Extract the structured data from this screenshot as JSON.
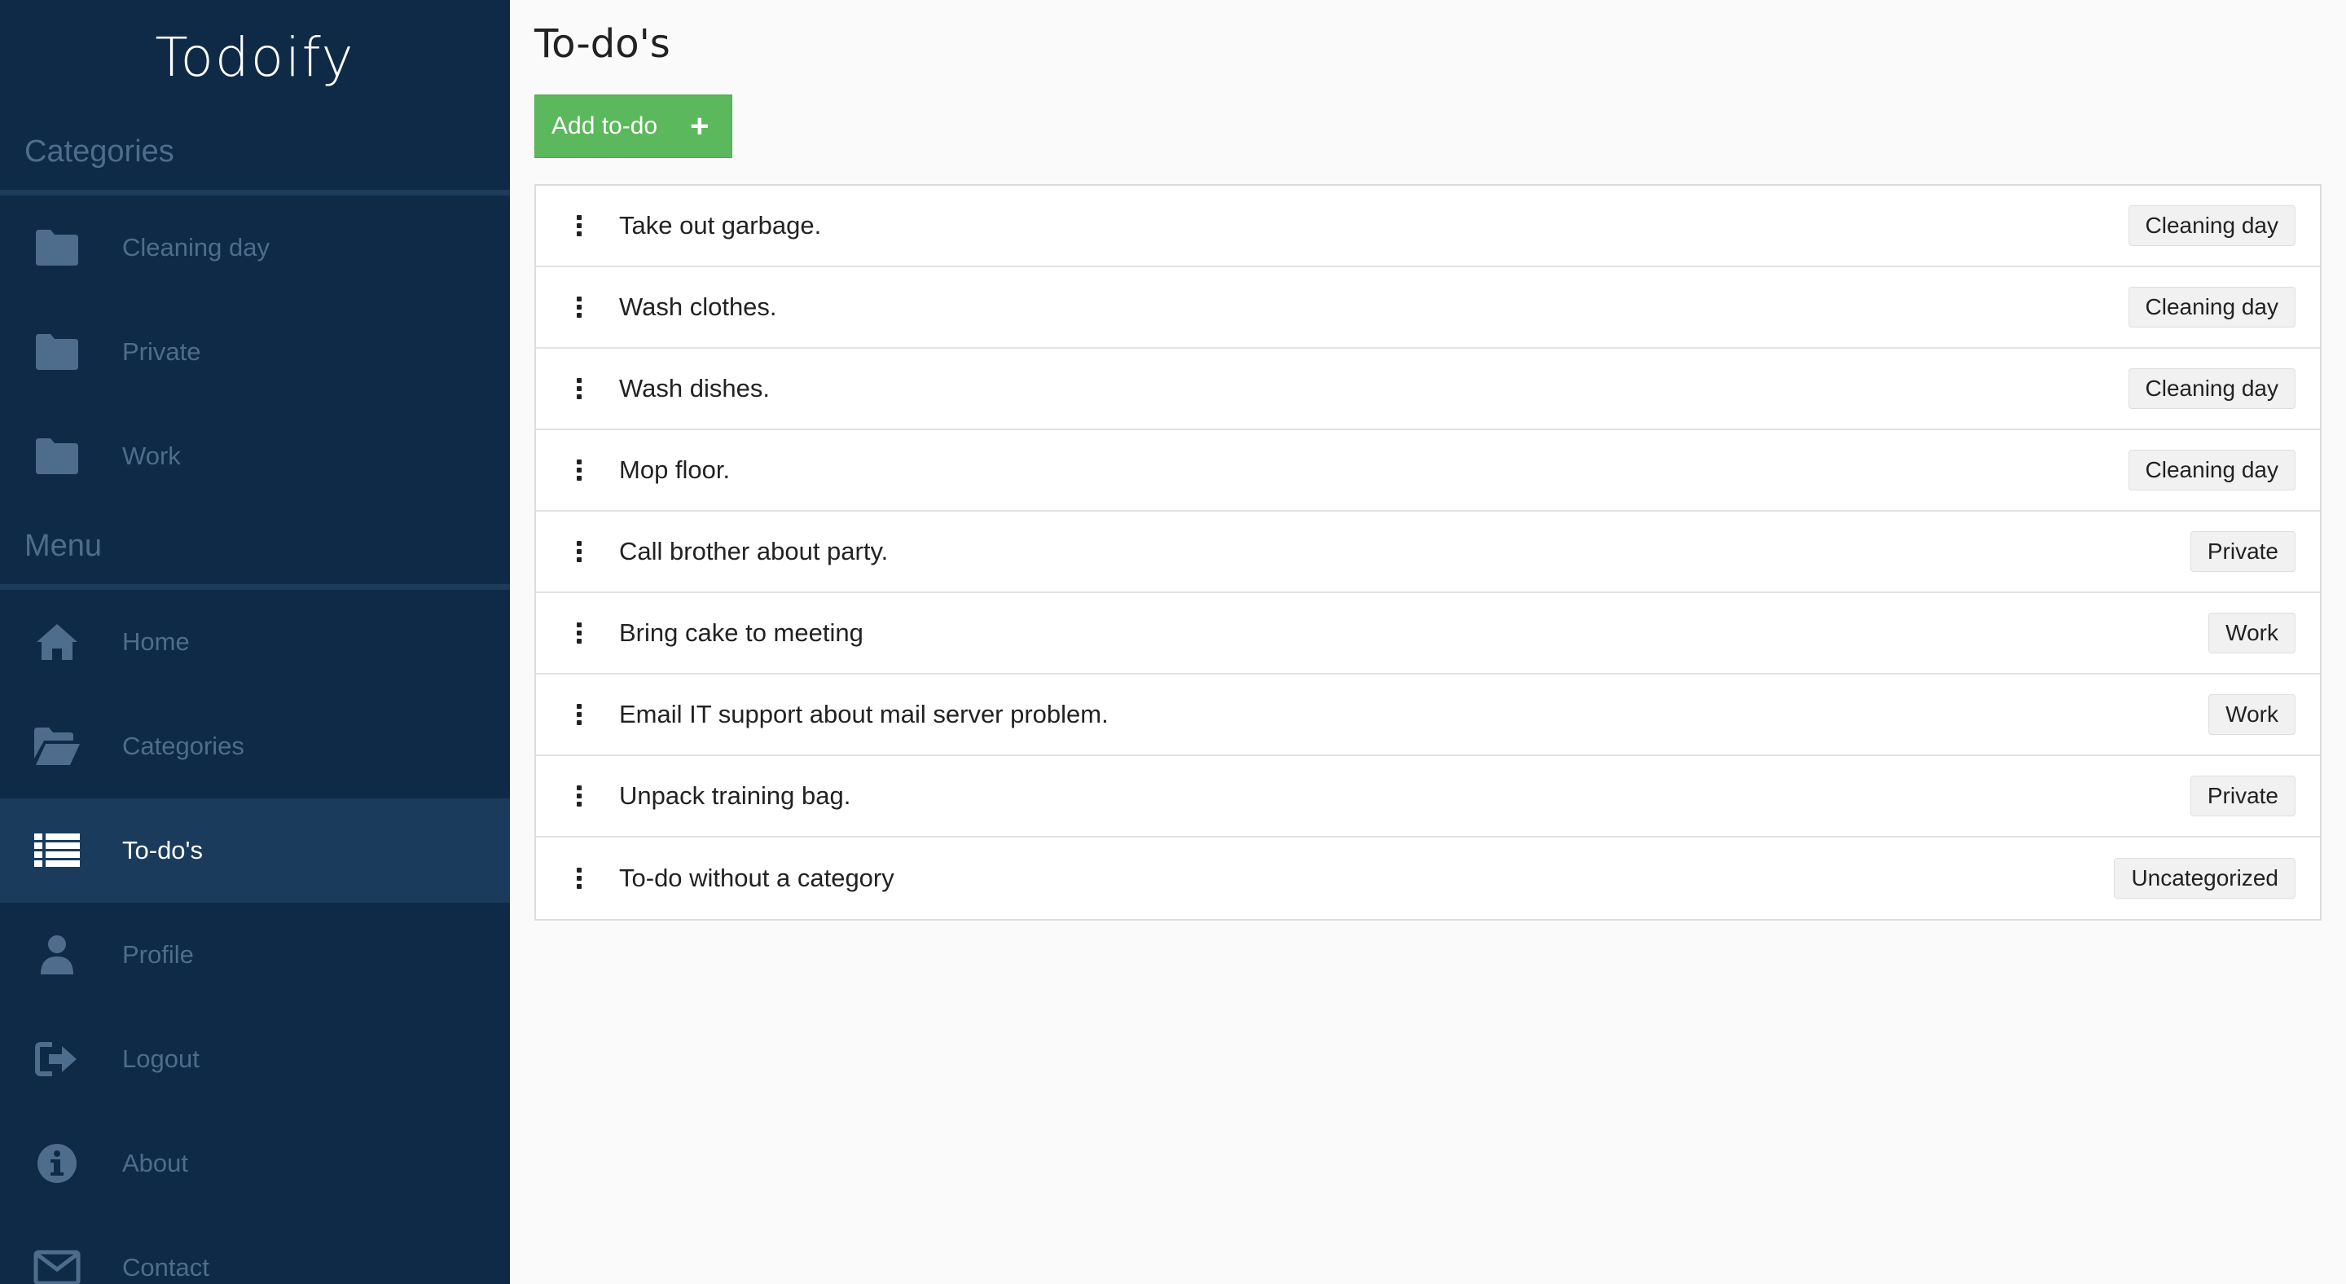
{
  "app": {
    "brand": "Todoify"
  },
  "sidebar": {
    "categories_title": "Categories",
    "categories": [
      {
        "label": "Cleaning day",
        "icon": "folder-icon"
      },
      {
        "label": "Private",
        "icon": "folder-icon"
      },
      {
        "label": "Work",
        "icon": "folder-icon"
      }
    ],
    "menu_title": "Menu",
    "menu": [
      {
        "label": "Home",
        "icon": "home-icon"
      },
      {
        "label": "Categories",
        "icon": "folder-open-icon"
      },
      {
        "label": "To-do's",
        "icon": "list-icon",
        "active": true
      },
      {
        "label": "Profile",
        "icon": "user-icon"
      },
      {
        "label": "Logout",
        "icon": "logout-icon"
      },
      {
        "label": "About",
        "icon": "info-icon"
      },
      {
        "label": "Contact",
        "icon": "envelope-icon"
      }
    ]
  },
  "main": {
    "title": "To-do's",
    "add_button_label": "Add to-do",
    "add_button_icon": "+",
    "todos": [
      {
        "text": "Take out garbage.",
        "category": "Cleaning day"
      },
      {
        "text": "Wash clothes.",
        "category": "Cleaning day"
      },
      {
        "text": "Wash dishes.",
        "category": "Cleaning day"
      },
      {
        "text": "Mop floor.",
        "category": "Cleaning day"
      },
      {
        "text": "Call brother about party.",
        "category": "Private"
      },
      {
        "text": "Bring cake to meeting",
        "category": "Work"
      },
      {
        "text": "Email IT support about mail server problem.",
        "category": "Work"
      },
      {
        "text": "Unpack training bag.",
        "category": "Private"
      },
      {
        "text": "To-do without a category",
        "category": "Uncategorized"
      }
    ]
  },
  "colors": {
    "sidebar_bg": "#0f2a47",
    "sidebar_active_bg": "#1b3b5d",
    "sidebar_muted_text": "#4e6d8c",
    "add_button": "#5cb85c"
  }
}
